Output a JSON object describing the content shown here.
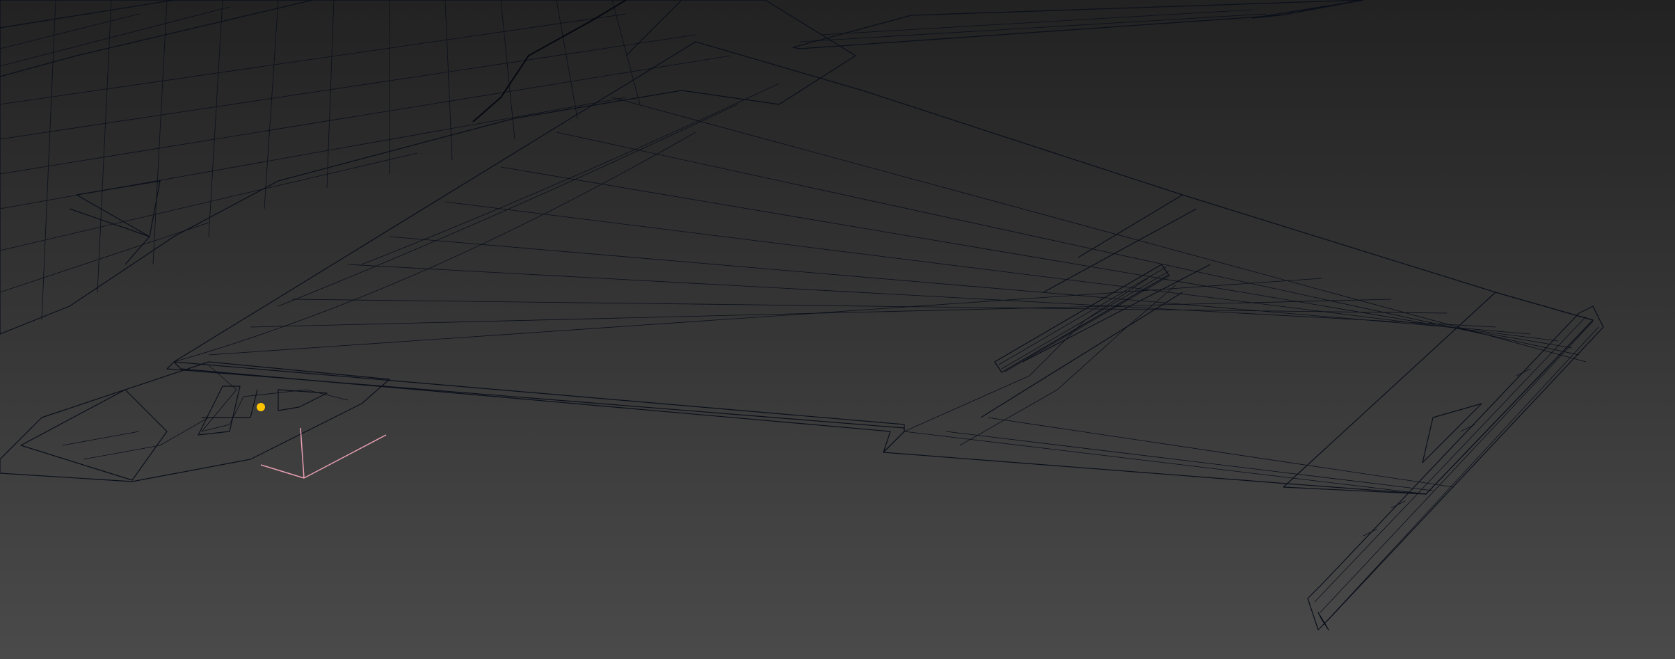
{
  "viewport": {
    "background_top": "#222222",
    "background_bottom": "#4a4a4a",
    "colors": {
      "blue_light": "#1f6ad0",
      "blue_mid": "#0d55b6",
      "blue_dark": "#083c86",
      "yellow": "#ffc400",
      "yellow_dark": "#e0a400",
      "wire": "#0a0f1a",
      "pivot": "#e9a0b4"
    },
    "icons": {
      "pivot": "transform-pivot-icon"
    }
  }
}
